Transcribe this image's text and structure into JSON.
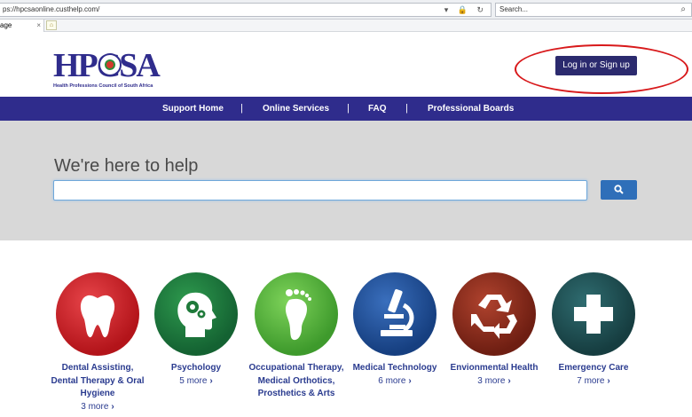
{
  "browser": {
    "address": "ps://hpcsaonline.custhelp.com/",
    "search_placeholder": "Search...",
    "tab_label": "age",
    "tab_close": "×"
  },
  "header": {
    "logo_text": "HPCSA",
    "logo_subtitle": "Health Professions Council of South Africa",
    "login_label": "Log in or Sign up"
  },
  "nav": {
    "items": [
      "Support Home",
      "Online Services",
      "FAQ",
      "Professional Boards"
    ],
    "separator": "|"
  },
  "hero": {
    "title": "We're here to help",
    "search_value": ""
  },
  "categories": [
    {
      "name": "Dental Assisting, Dental Therapy & Oral Hygiene",
      "more": "3 more",
      "color": "#c8181c",
      "icon": "tooth-icon"
    },
    {
      "name": "Psychology",
      "more": "5 more",
      "color": "#1f7a3a",
      "icon": "head-gears-icon"
    },
    {
      "name": "Occupational Therapy, Medical Orthotics, Prosthetics & Arts",
      "more": "",
      "color": "#4fb33b",
      "icon": "footprint-icon"
    },
    {
      "name": "Medical Technology",
      "more": "6 more",
      "color": "#1e4f96",
      "icon": "microscope-icon"
    },
    {
      "name": "Envionmental Health",
      "more": "3 more",
      "color": "#8a2a1c",
      "icon": "recycle-icon"
    },
    {
      "name": "Emergency Care",
      "more": "7 more",
      "color": "#1f4f52",
      "icon": "medical-cross-icon"
    }
  ],
  "colors": {
    "nav_bg": "#2f2c8c",
    "login_bg": "#2b2a6e",
    "hero_bg": "#d8d8d8",
    "search_btn": "#2f6fb9",
    "link": "#2a3b8f",
    "annotation": "#d8191b"
  }
}
